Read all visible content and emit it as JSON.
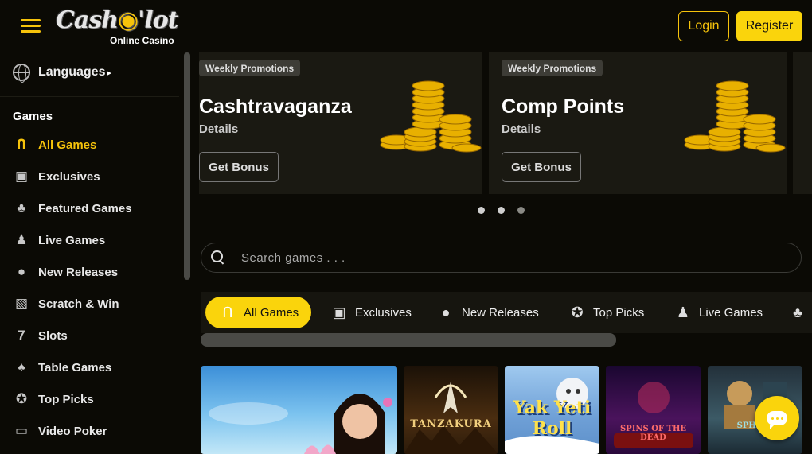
{
  "header": {
    "logo_text": "Cash o'lot",
    "logo_subtitle": "Online Casino",
    "login_label": "Login",
    "register_label": "Register"
  },
  "sidebar": {
    "languages_label": "Languages",
    "languages_arrow": "▸",
    "section_title": "Games",
    "items": [
      {
        "label": "All Games",
        "icon": "horseshoe-icon",
        "active": true
      },
      {
        "label": "Exclusives",
        "icon": "exclusive-icon",
        "active": false
      },
      {
        "label": "Featured Games",
        "icon": "clover-icon",
        "active": false
      },
      {
        "label": "Live Games",
        "icon": "dealer-icon",
        "active": false
      },
      {
        "label": "New Releases",
        "icon": "cherries-icon",
        "active": false
      },
      {
        "label": "Scratch & Win",
        "icon": "scratch-icon",
        "active": false
      },
      {
        "label": "Slots",
        "icon": "seven-icon",
        "active": false
      },
      {
        "label": "Table Games",
        "icon": "card-icon",
        "active": false
      },
      {
        "label": "Top Picks",
        "icon": "award-icon",
        "active": false
      },
      {
        "label": "Video Poker",
        "icon": "monitor-icon",
        "active": false
      }
    ]
  },
  "promos": [
    {
      "tag": "Weekly Promotions",
      "title": "Cashtravaganza",
      "details": "Details",
      "button": "Get Bonus",
      "image": "gold-coins"
    },
    {
      "tag": "Weekly Promotions",
      "title": "Comp Points",
      "details": "Details",
      "button": "Get Bonus",
      "image": "gold-coins"
    }
  ],
  "carousel": {
    "dots": 3,
    "active_index": 0
  },
  "search": {
    "placeholder": "Search games . . ."
  },
  "tabs": [
    {
      "label": "All Games",
      "icon": "horseshoe-icon",
      "active": true
    },
    {
      "label": "Exclusives",
      "icon": "exclusive-icon",
      "active": false
    },
    {
      "label": "New Releases",
      "icon": "cherries-icon",
      "active": false
    },
    {
      "label": "Top Picks",
      "icon": "award-icon",
      "active": false
    },
    {
      "label": "Live Games",
      "icon": "dealer-icon",
      "active": false
    }
  ],
  "games": [
    {
      "title": "",
      "art": "asian-woman-lotus"
    },
    {
      "title": "TANZAKURA",
      "art": "crane-sunset"
    },
    {
      "title": "Yak Yeti Roll",
      "art": "yeti-snow"
    },
    {
      "title": "SPINS OF THE DEAD",
      "art": "purple-graveyard"
    },
    {
      "title": "SPHINX",
      "art": "sphinx-cartoon"
    }
  ],
  "colors": {
    "accent": "#fad40c",
    "background": "#0b0a05",
    "panel": "#1a1912"
  }
}
